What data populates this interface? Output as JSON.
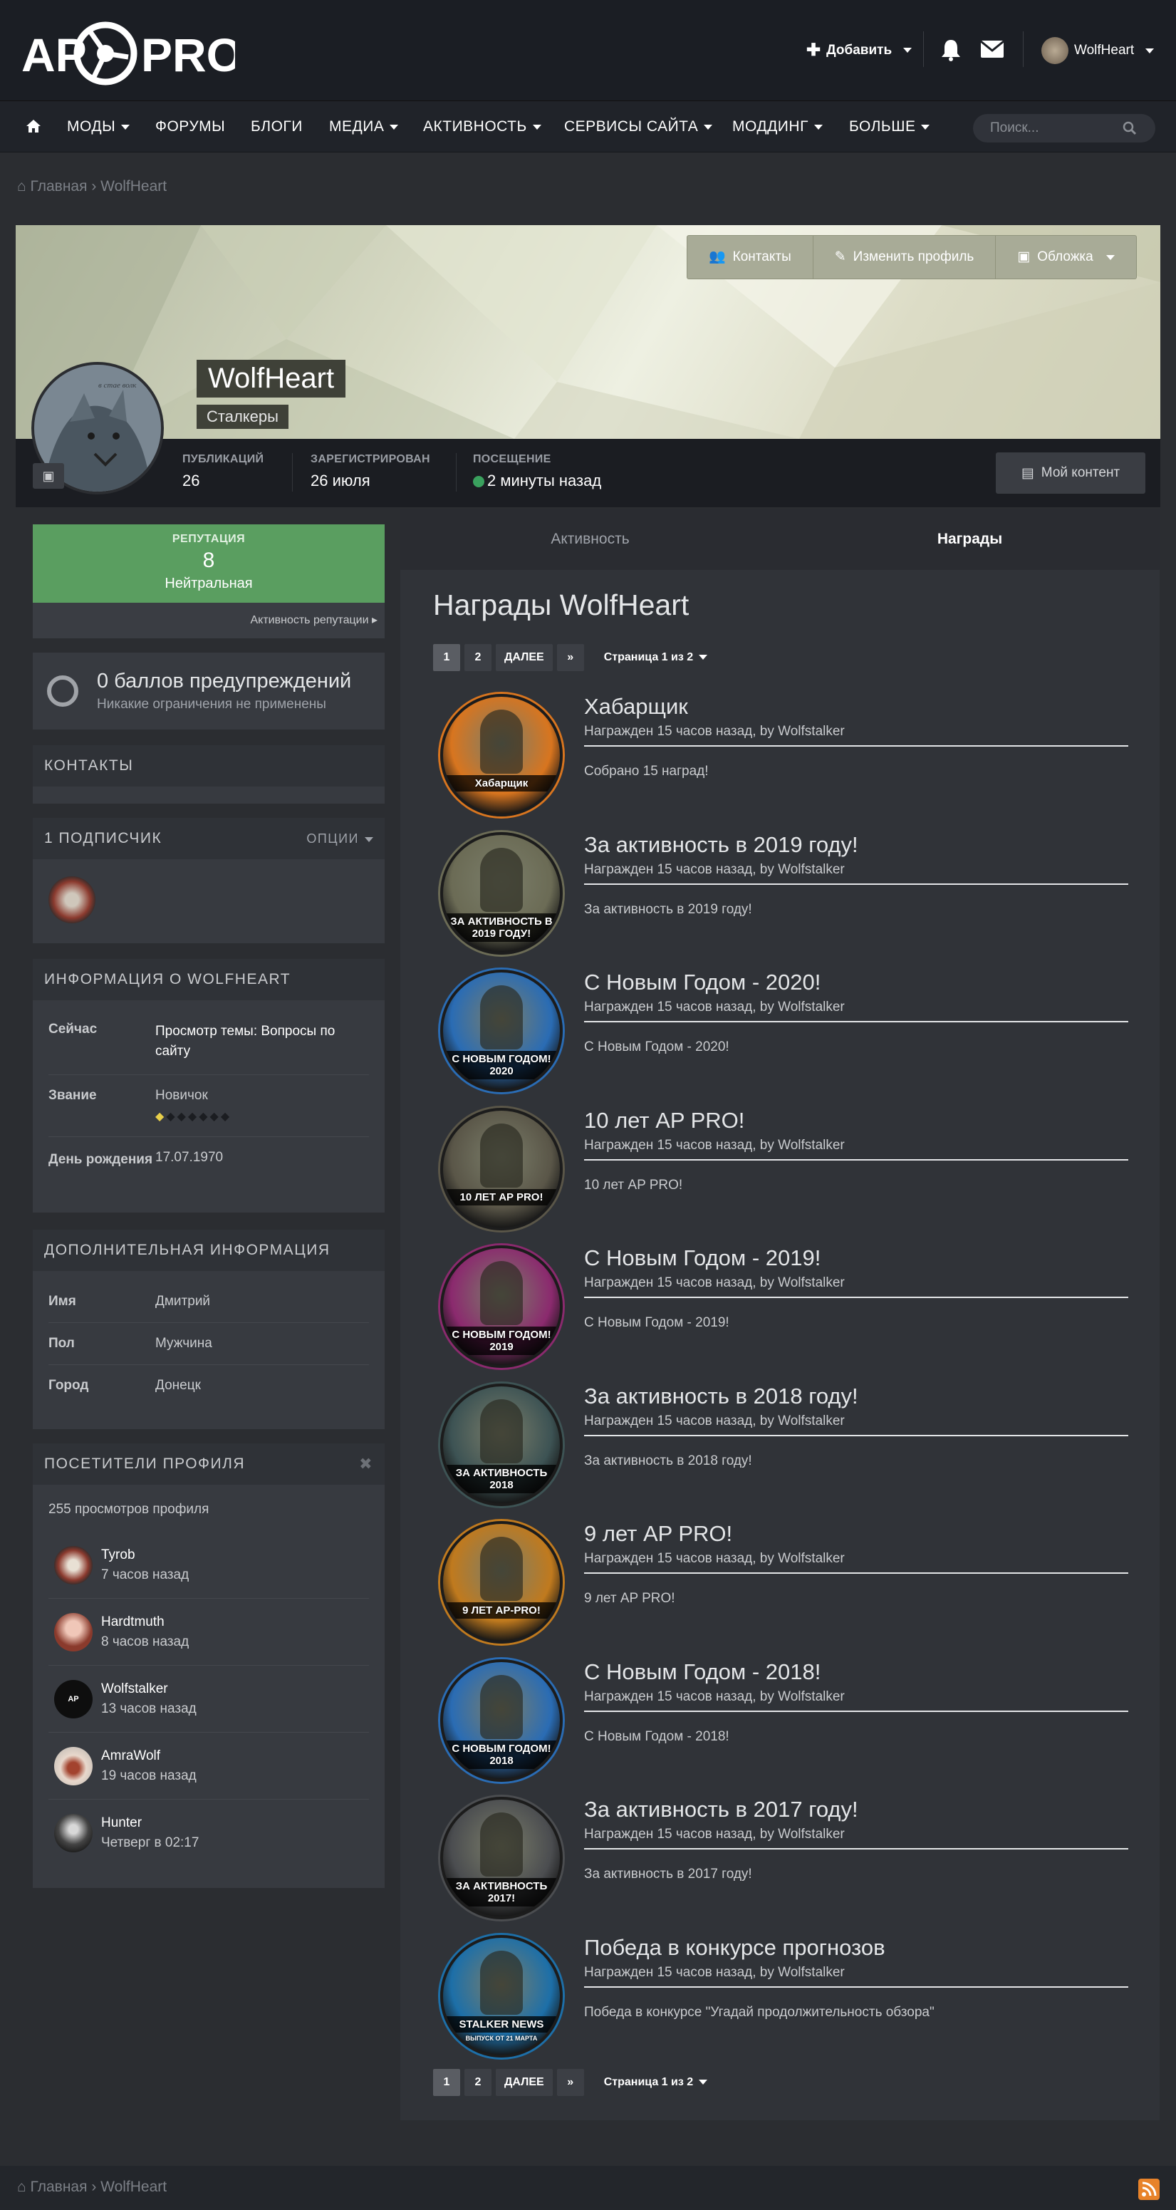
{
  "header": {
    "logo_text": "AP PRO",
    "add_label": "Добавить",
    "user_name": "WolfHeart"
  },
  "nav": {
    "items": [
      {
        "label": "МОДЫ",
        "dropdown": true
      },
      {
        "label": "ФОРУМЫ",
        "dropdown": false
      },
      {
        "label": "БЛОГИ",
        "dropdown": false
      },
      {
        "label": "МЕДИА",
        "dropdown": true
      },
      {
        "label": "АКТИВНОСТЬ",
        "dropdown": true
      },
      {
        "label": "СЕРВИСЫ САЙТА",
        "dropdown": true
      },
      {
        "label": "МОДДИНГ",
        "dropdown": true
      },
      {
        "label": "БОЛЬШЕ",
        "dropdown": true
      }
    ],
    "search_placeholder": "Поиск..."
  },
  "breadcrumb": {
    "home": "Главная",
    "current": "WolfHeart"
  },
  "profile": {
    "name": "WolfHeart",
    "group": "Сталкеры",
    "buttons": {
      "contacts": "Контакты",
      "edit": "Изменить профиль",
      "cover": "Обложка"
    },
    "stats": [
      {
        "label": "ПУБЛИКАЦИЙ",
        "value": "26"
      },
      {
        "label": "ЗАРЕГИСТРИРОВАН",
        "value": "26 июля"
      },
      {
        "label": "ПОСЕЩЕНИЕ",
        "value": "2 минуты назад"
      }
    ],
    "my_content": "Мой контент"
  },
  "reputation": {
    "label": "РЕПУТАЦИЯ",
    "value": "8",
    "status": "Нейтральная",
    "activity": "Активность репутации"
  },
  "warnings": {
    "title": "0 баллов предупреждений",
    "sub": "Никакие ограничения не применены"
  },
  "contacts": {
    "title": "КОНТАКТЫ"
  },
  "followers": {
    "title": "1 ПОДПИСЧИК",
    "options": "ОПЦИИ"
  },
  "info": {
    "title": "ИНФОРМАЦИЯ О WOLFHEART",
    "rows": [
      {
        "k": "Сейчас",
        "v": "Просмотр темы: Вопросы по сайту"
      },
      {
        "k": "Звание",
        "v": "Новичок"
      },
      {
        "k": "День рождения",
        "v": "17.07.1970"
      }
    ],
    "rank_pips": 7,
    "rank_filled": 1
  },
  "extra": {
    "title": "ДОПОЛНИТЕЛЬНАЯ ИНФОРМАЦИЯ",
    "rows": [
      {
        "k": "Имя",
        "v": "Дмитрий"
      },
      {
        "k": "Пол",
        "v": "Мужчина"
      },
      {
        "k": "Город",
        "v": "Донецк"
      }
    ]
  },
  "visitors": {
    "title": "ПОСЕТИТЕЛИ ПРОФИЛЯ",
    "views": "255 просмотров профиля",
    "list": [
      {
        "name": "Tyrob",
        "time": "7 часов назад"
      },
      {
        "name": "Hardtmuth",
        "time": "8 часов назад"
      },
      {
        "name": "Wolfstalker",
        "time": "13 часов назад"
      },
      {
        "name": "AmraWolf",
        "time": "19 часов назад"
      },
      {
        "name": "Hunter",
        "time": "Четверг в 02:17"
      }
    ]
  },
  "tabs": [
    {
      "label": "Активность"
    },
    {
      "label": "Награды"
    }
  ],
  "awards": {
    "title": "Награды WolfHeart",
    "pager": {
      "p1": "1",
      "p2": "2",
      "next": "ДАЛЕЕ",
      "last": "»",
      "page_of": "Страница 1 из 2"
    },
    "items": [
      {
        "title": "Хабарщик",
        "meta": "Награжден 15 часов назад, by Wolfstalker",
        "desc": "Собрано 15 наград!",
        "badge": "Хабарщик",
        "color": "#d8751f"
      },
      {
        "title": "За активность в 2019 году!",
        "meta": "Награжден 15 часов назад, by Wolfstalker",
        "desc": "За активность в 2019 году!",
        "badge": "ЗА АКТИВНОСТЬ В 2019 ГОДУ!",
        "color": "#6b6b55"
      },
      {
        "title": "С Новым Годом  - 2020!",
        "meta": "Награжден 15 часов назад, by Wolfstalker",
        "desc": "С Новым Годом  - 2020!",
        "badge": "С НОВЫМ ГОДОМ! 2020",
        "color": "#2a6cb4"
      },
      {
        "title": "10 лет AP PRO!",
        "meta": "Награжден 15 часов назад, by Wolfstalker",
        "desc": "10 лет AP PRO!",
        "badge": "10 ЛЕТ AP PRO!",
        "color": "#5a5648"
      },
      {
        "title": "С Новым Годом  - 2019!",
        "meta": "Награжден 15 часов назад, by Wolfstalker",
        "desc": "С Новым Годом  - 2019!",
        "badge": "С НОВЫМ ГОДОМ! 2019",
        "color": "#8b2a6e"
      },
      {
        "title": "За активность в 2018 году!",
        "meta": "Награжден 15 часов назад, by Wolfstalker",
        "desc": "За активность в 2018 году!",
        "badge": "ЗА АКТИВНОСТЬ 2018",
        "color": "#3d5354"
      },
      {
        "title": "9 лет AP PRO!",
        "meta": "Награжден 15 часов назад, by Wolfstalker",
        "desc": "9 лет AP PRO!",
        "badge": "9 ЛЕТ AP-PRO!",
        "color": "#c07a1e"
      },
      {
        "title": "С Новым Годом - 2018!",
        "meta": "Награжден 15 часов назад, by Wolfstalker",
        "desc": "С Новым Годом - 2018!",
        "badge": "С НОВЫМ ГОДОМ! 2018",
        "color": "#2a6cb4"
      },
      {
        "title": "За активность в 2017 году!",
        "meta": "Награжден 15 часов назад, by Wolfstalker",
        "desc": "За активность в 2017 году!",
        "badge": "ЗА АКТИВНОСТЬ 2017!",
        "color": "#4b4d50"
      },
      {
        "title": "Победа в конкурсе прогнозов",
        "meta": "Награжден 15 часов назад, by Wolfstalker",
        "desc": "Победа в конкурсе \"Угадай продолжительность обзора\"",
        "badge": "STALKER NEWS",
        "badge_sub": "ВЫПУСК ОТ 21 МАРТА",
        "color": "#1d6fa8"
      }
    ]
  },
  "footer": {
    "home": "Главная",
    "current": "WolfHeart"
  },
  "colors": {
    "reputation_green": "#5a9e60",
    "online_dot": "#3aa15e",
    "accent": "#f08a24"
  }
}
